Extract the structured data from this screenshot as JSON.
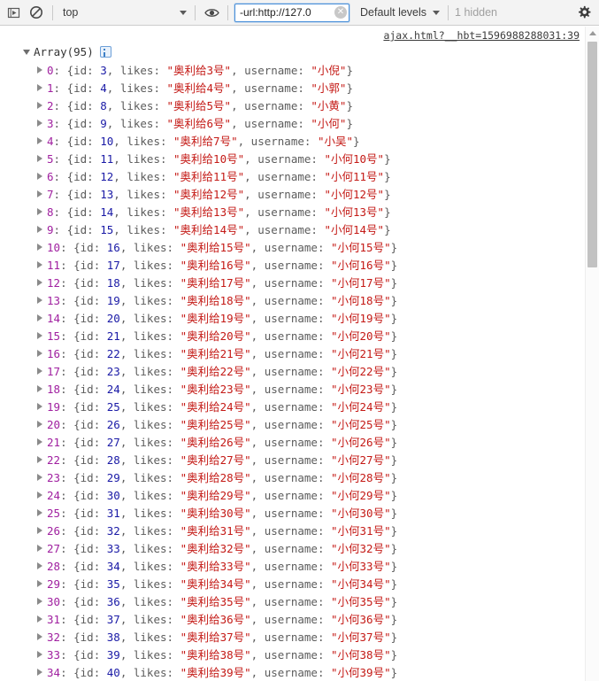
{
  "toolbar": {
    "step_icon": "execution-context-icon",
    "clear_icon": "clear-console-icon",
    "context_value": "top",
    "eye_icon": "eye-icon",
    "filter_value": "-url:http://127.0",
    "filter_placeholder": "Filter",
    "clear_filter_icon": "close-icon",
    "levels_label": "Default levels",
    "hidden_label": "1 hidden",
    "settings_icon": "gear-icon",
    "dropdown_icon": "chevron-down-icon"
  },
  "source_link": "ajax.html?__hbt=1596988288031:39",
  "console": {
    "array_label": "Array(95)",
    "info_icon": "info-icon",
    "expand_icon": "triangle-down-icon",
    "row_expand_icon": "triangle-right-icon",
    "keys": {
      "id": "id:",
      "likes": "likes:",
      "username": "username:"
    },
    "punct": {
      "open": "{",
      "close": "}",
      "comma": ",",
      "colon": ":",
      "quote": "\""
    },
    "rows": [
      {
        "index": "0",
        "id": "3",
        "likes": "奥利给3号",
        "username": "小倪"
      },
      {
        "index": "1",
        "id": "4",
        "likes": "奥利给4号",
        "username": "小郭"
      },
      {
        "index": "2",
        "id": "8",
        "likes": "奥利给5号",
        "username": "小黄"
      },
      {
        "index": "3",
        "id": "9",
        "likes": "奥利给6号",
        "username": "小何"
      },
      {
        "index": "4",
        "id": "10",
        "likes": "奥利给7号",
        "username": "小吴"
      },
      {
        "index": "5",
        "id": "11",
        "likes": "奥利给10号",
        "username": "小何10号"
      },
      {
        "index": "6",
        "id": "12",
        "likes": "奥利给11号",
        "username": "小何11号"
      },
      {
        "index": "7",
        "id": "13",
        "likes": "奥利给12号",
        "username": "小何12号"
      },
      {
        "index": "8",
        "id": "14",
        "likes": "奥利给13号",
        "username": "小何13号"
      },
      {
        "index": "9",
        "id": "15",
        "likes": "奥利给14号",
        "username": "小何14号"
      },
      {
        "index": "10",
        "id": "16",
        "likes": "奥利给15号",
        "username": "小何15号"
      },
      {
        "index": "11",
        "id": "17",
        "likes": "奥利给16号",
        "username": "小何16号"
      },
      {
        "index": "12",
        "id": "18",
        "likes": "奥利给17号",
        "username": "小何17号"
      },
      {
        "index": "13",
        "id": "19",
        "likes": "奥利给18号",
        "username": "小何18号"
      },
      {
        "index": "14",
        "id": "20",
        "likes": "奥利给19号",
        "username": "小何19号"
      },
      {
        "index": "15",
        "id": "21",
        "likes": "奥利给20号",
        "username": "小何20号"
      },
      {
        "index": "16",
        "id": "22",
        "likes": "奥利给21号",
        "username": "小何21号"
      },
      {
        "index": "17",
        "id": "23",
        "likes": "奥利给22号",
        "username": "小何22号"
      },
      {
        "index": "18",
        "id": "24",
        "likes": "奥利给23号",
        "username": "小何23号"
      },
      {
        "index": "19",
        "id": "25",
        "likes": "奥利给24号",
        "username": "小何24号"
      },
      {
        "index": "20",
        "id": "26",
        "likes": "奥利给25号",
        "username": "小何25号"
      },
      {
        "index": "21",
        "id": "27",
        "likes": "奥利给26号",
        "username": "小何26号"
      },
      {
        "index": "22",
        "id": "28",
        "likes": "奥利给27号",
        "username": "小何27号"
      },
      {
        "index": "23",
        "id": "29",
        "likes": "奥利给28号",
        "username": "小何28号"
      },
      {
        "index": "24",
        "id": "30",
        "likes": "奥利给29号",
        "username": "小何29号"
      },
      {
        "index": "25",
        "id": "31",
        "likes": "奥利给30号",
        "username": "小何30号"
      },
      {
        "index": "26",
        "id": "32",
        "likes": "奥利给31号",
        "username": "小何31号"
      },
      {
        "index": "27",
        "id": "33",
        "likes": "奥利给32号",
        "username": "小何32号"
      },
      {
        "index": "28",
        "id": "34",
        "likes": "奥利给33号",
        "username": "小何33号"
      },
      {
        "index": "29",
        "id": "35",
        "likes": "奥利给34号",
        "username": "小何34号"
      },
      {
        "index": "30",
        "id": "36",
        "likes": "奥利给35号",
        "username": "小何35号"
      },
      {
        "index": "31",
        "id": "37",
        "likes": "奥利给36号",
        "username": "小何36号"
      },
      {
        "index": "32",
        "id": "38",
        "likes": "奥利给37号",
        "username": "小何37号"
      },
      {
        "index": "33",
        "id": "39",
        "likes": "奥利给38号",
        "username": "小何38号"
      },
      {
        "index": "34",
        "id": "40",
        "likes": "奥利给39号",
        "username": "小何39号"
      }
    ]
  },
  "scrollbar": {
    "up_icon": "scroll-up-arrow-icon"
  }
}
